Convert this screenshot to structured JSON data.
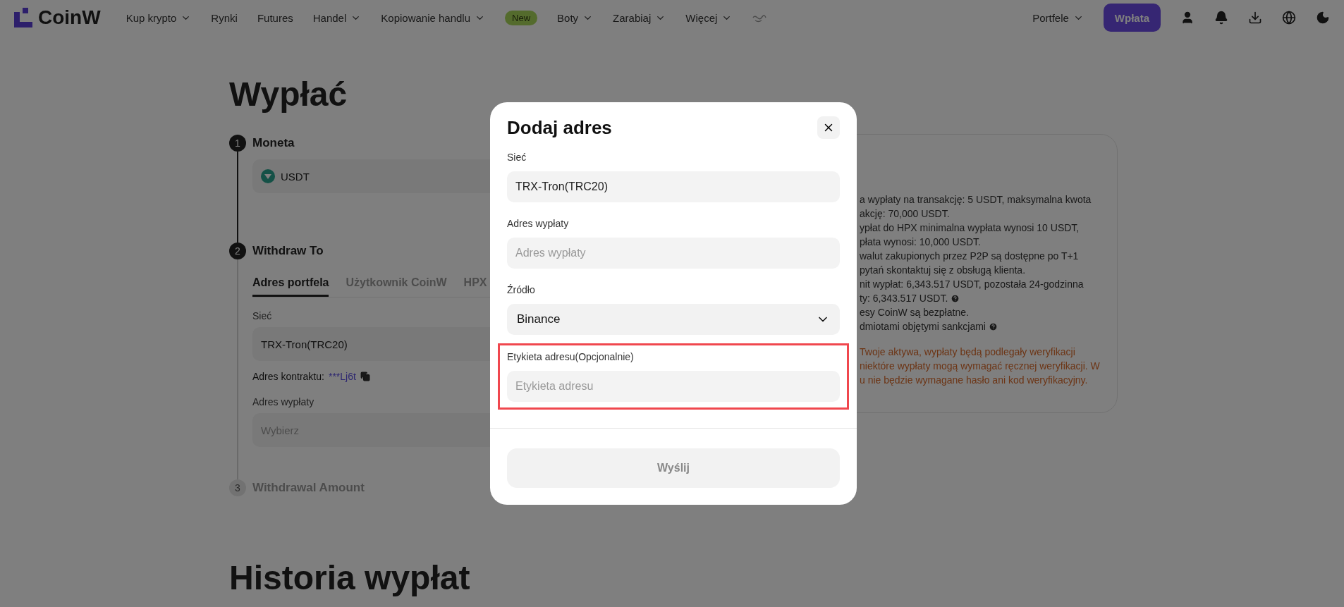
{
  "nav": {
    "logo": "CoinW",
    "items": [
      {
        "label": "Kup krypto",
        "dropdown": true
      },
      {
        "label": "Rynki",
        "dropdown": false
      },
      {
        "label": "Futures",
        "dropdown": false
      },
      {
        "label": "Handel",
        "dropdown": true
      },
      {
        "label": "Kopiowanie handlu",
        "dropdown": true,
        "badge": "New"
      },
      {
        "label": "Boty",
        "dropdown": true
      },
      {
        "label": "Zarabiaj",
        "dropdown": true
      },
      {
        "label": "Więcej",
        "dropdown": true
      }
    ],
    "wallet_menu": {
      "label": "Portfele",
      "dropdown": true
    },
    "deposit_button": "Wpłata"
  },
  "page_title": "Wypłać",
  "steps": [
    {
      "number": "1",
      "title": "Moneta",
      "active": true
    },
    {
      "number": "2",
      "title": "Withdraw To",
      "active": true
    },
    {
      "number": "3",
      "title": "Withdrawal Amount",
      "active": false
    }
  ],
  "coin_field": {
    "value": "USDT"
  },
  "withdraw_tabs": [
    {
      "label": "Adres portfela",
      "selected": true
    },
    {
      "label": "Użytkownik CoinW",
      "selected": false
    },
    {
      "label": "HPX",
      "selected": false
    }
  ],
  "network": {
    "label": "Sieć",
    "value": "TRX-Tron(TRC20)"
  },
  "contract": {
    "label": "Adres kontraktu:",
    "value": "***Lj6t"
  },
  "address": {
    "label": "Adres wypłaty",
    "placeholder": "Wybierz"
  },
  "info_panel": {
    "notes": [
      {
        "text": "a wypłaty na transakcję: 5 USDT, maksymalna kwota",
        "help": false
      },
      {
        "text": "akcję: 70,000 USDT.",
        "help": false
      },
      {
        "text": "ypłat do HPX minimalna wypłata wynosi 10 USDT,",
        "help": false
      },
      {
        "text": "płata wynosi: 10,000 USDT.",
        "help": false
      },
      {
        "text": "walut zakupionych przez P2P są dostępne po T+1",
        "help": false
      },
      {
        "text": "pytań skontaktuj się z obsługą klienta.",
        "help": false
      },
      {
        "text": "nit wypłat: 6,343.517 USDT, pozostała 24-godzinna",
        "help": false
      },
      {
        "text": "ty: 6,343.517 USDT.",
        "help": true
      },
      {
        "text": "esy CoinW są bezpłatne.",
        "help": false
      },
      {
        "text": "dmiotami objętymi sankcjami",
        "help": true
      }
    ],
    "warning": [
      "Twoje aktywa, wypłaty będą podlegały weryfikacji",
      "niektóre wypłaty mogą wymagać ręcznej weryfikacji. W",
      "u nie będzie wymagane hasło ani kod weryfikacyjny."
    ]
  },
  "history_title": "Historia wypłat",
  "modal": {
    "title": "Dodaj adres",
    "fields": [
      {
        "kind": "input",
        "label": "Sieć",
        "value": "TRX-Tron(TRC20)",
        "highlighted": false
      },
      {
        "kind": "input",
        "label": "Adres wypłaty",
        "placeholder": "Adres wypłaty",
        "highlighted": false
      },
      {
        "kind": "select",
        "label": "Źródło",
        "value": "Binance",
        "highlighted": false
      },
      {
        "kind": "input",
        "label": "Etykieta adresu(Opcjonalnie)",
        "placeholder": "Etykieta adresu",
        "highlighted": true
      }
    ],
    "submit": {
      "label": "Wyślij",
      "disabled": true
    }
  }
}
